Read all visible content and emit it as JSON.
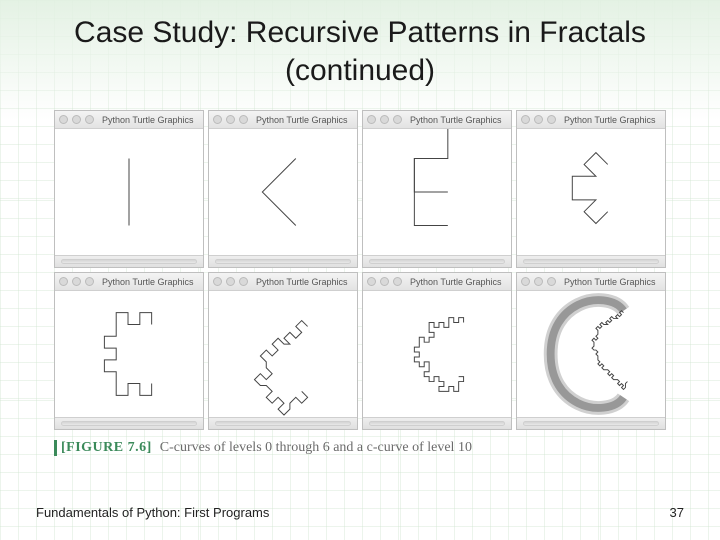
{
  "title": "Case Study: Recursive Patterns in Fractals (continued)",
  "window": {
    "title": "Python Turtle Graphics"
  },
  "figure": {
    "tag": "[FIGURE 7.6]",
    "caption": "C-curves of levels 0 through 6 and a c-curve of level 10"
  },
  "footer": {
    "book": "Fundamentals of Python: First Programs",
    "page": "37"
  }
}
